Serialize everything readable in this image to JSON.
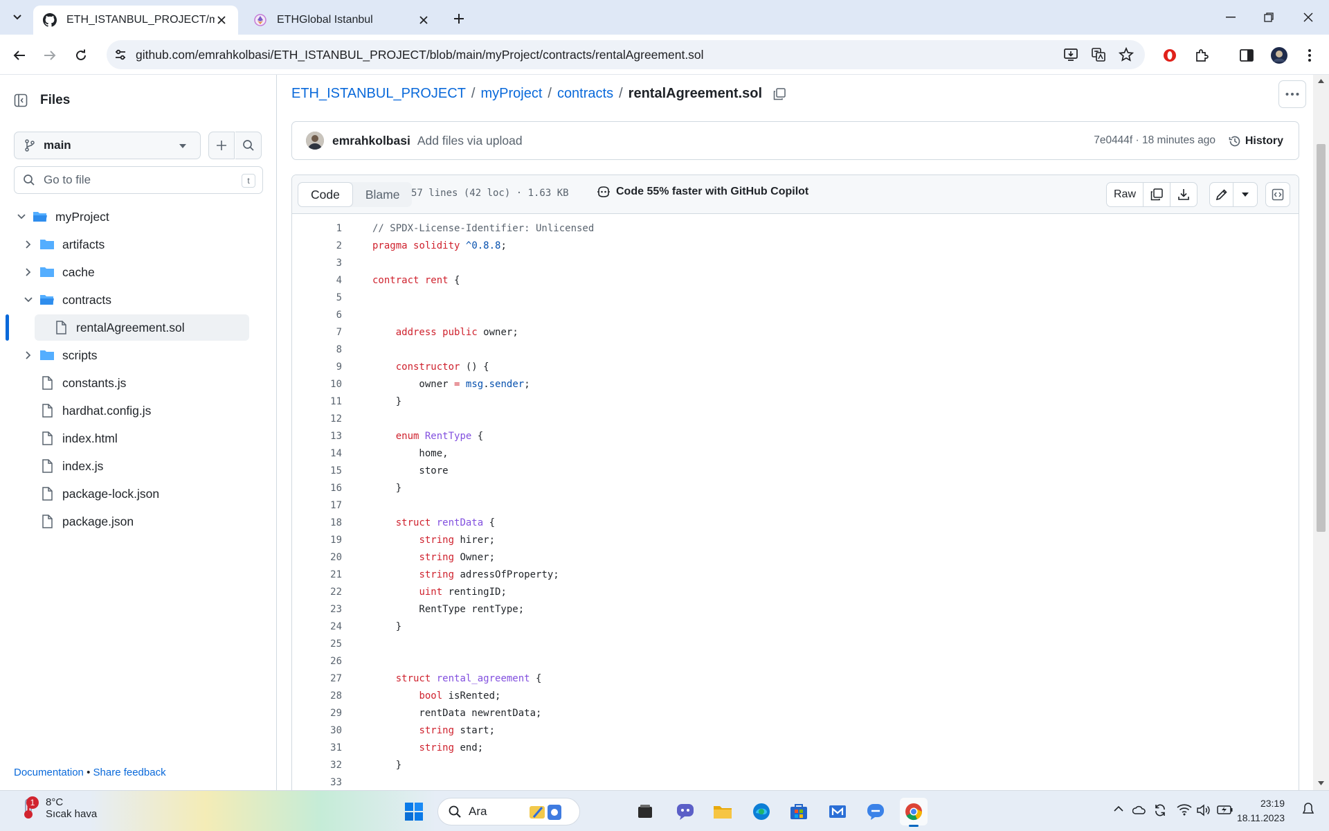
{
  "browser": {
    "tabs": [
      {
        "title": "ETH_ISTANBUL_PROJECT/myProject/contracts/rentalAgreement.sol",
        "active": true
      },
      {
        "title": "ETHGlobal Istanbul",
        "active": false
      }
    ],
    "url": "github.com/emrahkolbasi/ETH_ISTANBUL_PROJECT/blob/main/myProject/contracts/rentalAgreement.sol"
  },
  "sidebar": {
    "title": "Files",
    "branch": "main",
    "search_placeholder": "Go to file",
    "search_key": "t",
    "tree": [
      {
        "name": "myProject",
        "type": "folder",
        "depth": 0,
        "expanded": true
      },
      {
        "name": "artifacts",
        "type": "folder",
        "depth": 1,
        "expanded": false
      },
      {
        "name": "cache",
        "type": "folder",
        "depth": 1,
        "expanded": false
      },
      {
        "name": "contracts",
        "type": "folder",
        "depth": 1,
        "expanded": true
      },
      {
        "name": "rentalAgreement.sol",
        "type": "file",
        "depth": 2,
        "selected": true
      },
      {
        "name": "scripts",
        "type": "folder",
        "depth": 1,
        "expanded": false
      },
      {
        "name": "constants.js",
        "type": "file",
        "depth": 1
      },
      {
        "name": "hardhat.config.js",
        "type": "file",
        "depth": 1
      },
      {
        "name": "index.html",
        "type": "file",
        "depth": 1
      },
      {
        "name": "index.js",
        "type": "file",
        "depth": 1
      },
      {
        "name": "package-lock.json",
        "type": "file",
        "depth": 1
      },
      {
        "name": "package.json",
        "type": "file",
        "depth": 1
      }
    ],
    "footer": {
      "docs": "Documentation",
      "sep": "•",
      "feedback": "Share feedback"
    }
  },
  "breadcrumb": {
    "repo": "ETH_ISTANBUL_PROJECT",
    "folder1": "myProject",
    "folder2": "contracts",
    "file": "rentalAgreement.sol",
    "sep": "/"
  },
  "commit": {
    "author": "emrahkolbasi",
    "message": "Add files via upload",
    "meta": "7e0444f · 18 minutes ago",
    "history_label": "History"
  },
  "file_header": {
    "code_tab": "Code",
    "blame_tab": "Blame",
    "info": "57 lines (42 loc) · 1.63 KB",
    "copilot": "Code 55% faster with GitHub Copilot",
    "raw_label": "Raw"
  },
  "code_lines": [
    [
      [
        "c",
        "// SPDX-License-Identifier: Unlicensed"
      ]
    ],
    [
      [
        "k",
        "pragma"
      ],
      [
        "p",
        " "
      ],
      [
        "k",
        "solidity"
      ],
      [
        "p",
        " "
      ],
      [
        "n",
        "^0.8.8"
      ],
      [
        "p",
        ";"
      ]
    ],
    [],
    [
      [
        "k",
        "contract"
      ],
      [
        "p",
        " "
      ],
      [
        "k",
        "rent"
      ],
      [
        "p",
        " {"
      ]
    ],
    [],
    [],
    [
      [
        "p",
        "    "
      ],
      [
        "k",
        "address"
      ],
      [
        "p",
        " "
      ],
      [
        "k",
        "public"
      ],
      [
        "p",
        " owner;"
      ]
    ],
    [],
    [
      [
        "p",
        "    "
      ],
      [
        "k",
        "constructor"
      ],
      [
        "p",
        " () {"
      ]
    ],
    [
      [
        "p",
        "        owner "
      ],
      [
        "k",
        "="
      ],
      [
        "p",
        " "
      ],
      [
        "n",
        "msg"
      ],
      [
        "p",
        "."
      ],
      [
        "n",
        "sender"
      ],
      [
        "p",
        ";"
      ]
    ],
    [
      [
        "p",
        "    }"
      ]
    ],
    [],
    [
      [
        "p",
        "    "
      ],
      [
        "k",
        "enum"
      ],
      [
        "p",
        " "
      ],
      [
        "t",
        "RentType"
      ],
      [
        "p",
        " {"
      ]
    ],
    [
      [
        "p",
        "        home,"
      ]
    ],
    [
      [
        "p",
        "        store"
      ]
    ],
    [
      [
        "p",
        "    }"
      ]
    ],
    [],
    [
      [
        "p",
        "    "
      ],
      [
        "k",
        "struct"
      ],
      [
        "p",
        " "
      ],
      [
        "t",
        "rentData"
      ],
      [
        "p",
        " {"
      ]
    ],
    [
      [
        "p",
        "        "
      ],
      [
        "k",
        "string"
      ],
      [
        "p",
        " hirer;"
      ]
    ],
    [
      [
        "p",
        "        "
      ],
      [
        "k",
        "string"
      ],
      [
        "p",
        " Owner;"
      ]
    ],
    [
      [
        "p",
        "        "
      ],
      [
        "k",
        "string"
      ],
      [
        "p",
        " adressOfProperty;"
      ]
    ],
    [
      [
        "p",
        "        "
      ],
      [
        "k",
        "uint"
      ],
      [
        "p",
        " rentingID;"
      ]
    ],
    [
      [
        "p",
        "        RentType rentType;"
      ]
    ],
    [
      [
        "p",
        "    }"
      ]
    ],
    [],
    [],
    [
      [
        "p",
        "    "
      ],
      [
        "k",
        "struct"
      ],
      [
        "p",
        " "
      ],
      [
        "t",
        "rental_agreement"
      ],
      [
        "p",
        " {"
      ]
    ],
    [
      [
        "p",
        "        "
      ],
      [
        "k",
        "bool"
      ],
      [
        "p",
        " isRented;"
      ]
    ],
    [
      [
        "p",
        "        rentData newrentData;"
      ]
    ],
    [
      [
        "p",
        "        "
      ],
      [
        "k",
        "string"
      ],
      [
        "p",
        " start;"
      ]
    ],
    [
      [
        "p",
        "        "
      ],
      [
        "k",
        "string"
      ],
      [
        "p",
        " end;"
      ]
    ],
    [
      [
        "p",
        "    }"
      ]
    ],
    []
  ],
  "taskbar": {
    "weather_temp": "8°C",
    "weather_desc": "Sıcak hava",
    "notification_count": "1",
    "search_label": "Ara",
    "time": "23:19",
    "date": "18.11.2023"
  },
  "colors": {
    "accent": "#0969da",
    "keyword": "#cf222e",
    "type": "#8250df",
    "constant": "#0550ae",
    "comment": "#59636e"
  }
}
